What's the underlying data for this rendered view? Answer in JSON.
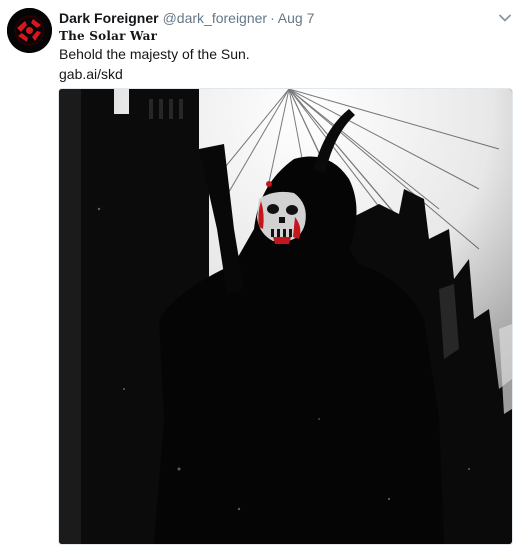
{
  "tweet": {
    "display_name": "Dark Foreigner",
    "handle": "@dark_foreigner",
    "separator": "·",
    "timestamp": "Aug 7",
    "subtitle": "The Solar War",
    "text_line1": "Behold the majesty of the Sun.",
    "text_line2": "gab.ai/skd"
  },
  "icons": {
    "menu": "chevron-down-icon",
    "avatar": "avatar"
  },
  "colors": {
    "muted": "#657786",
    "text": "#14171a",
    "blood": "#c4161c"
  }
}
